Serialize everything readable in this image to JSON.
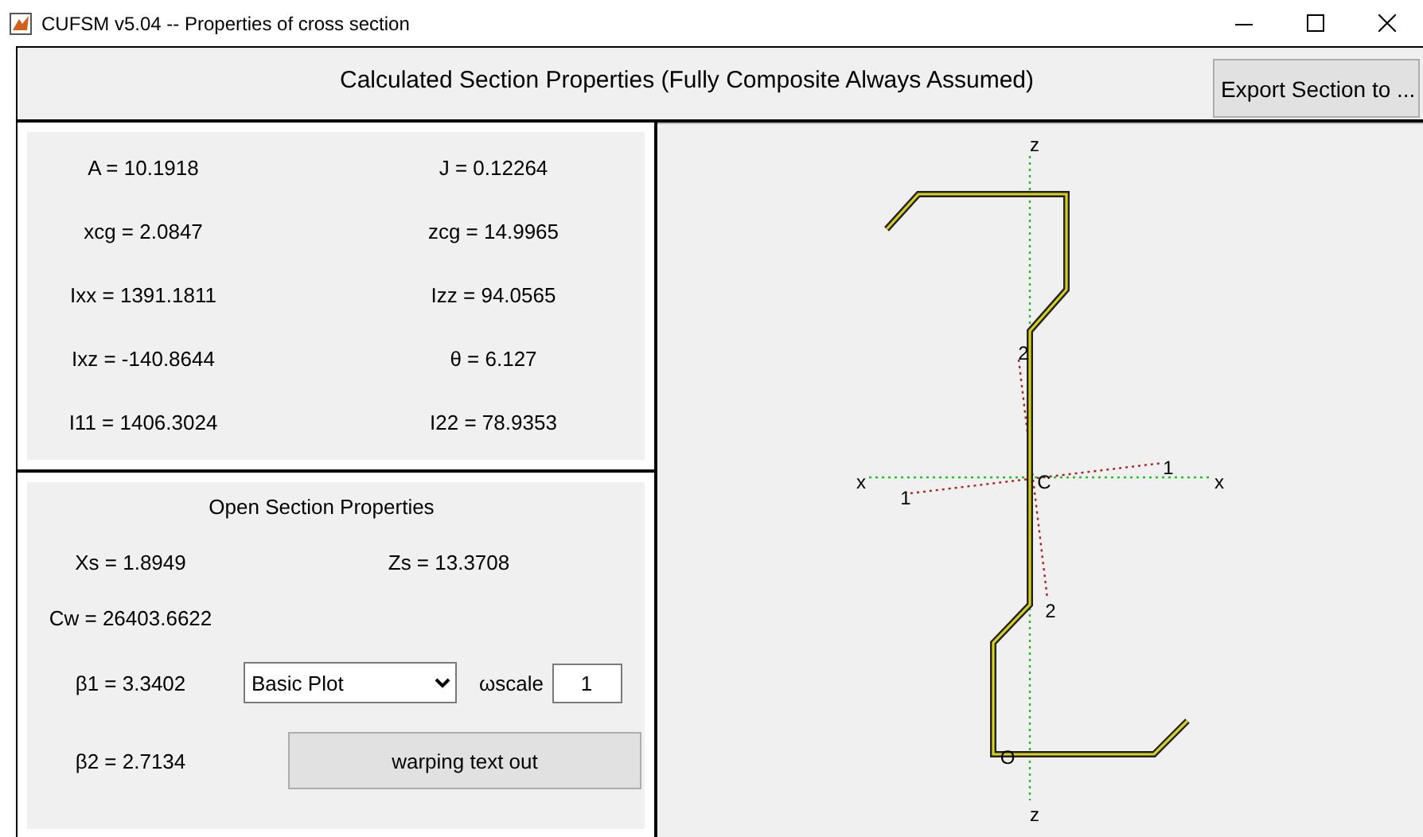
{
  "window": {
    "title": "CUFSM v5.04 -- Properties of cross section"
  },
  "header": {
    "title": "Calculated Section Properties (Fully Composite Always Assumed)",
    "export_button": "Export Section to ..."
  },
  "section_properties": [
    {
      "text": "A = 10.1918"
    },
    {
      "text": "J = 0.12264"
    },
    {
      "text": "xcg = 2.0847"
    },
    {
      "text": "zcg = 14.9965"
    },
    {
      "text": "Ixx = 1391.1811"
    },
    {
      "text": "Izz = 94.0565"
    },
    {
      "text": "Ixz = -140.8644"
    },
    {
      "text": "θ = 6.127"
    },
    {
      "text": "I11 = 1406.3024"
    },
    {
      "text": "I22 = 78.9353"
    }
  ],
  "open_section": {
    "title": "Open Section Properties",
    "xs": "Xs = 1.8949",
    "zs": "Zs = 13.3708",
    "cw": "Cw = 26403.6622",
    "beta1": "β1 = 3.3402",
    "beta2": "β2 = 2.7134",
    "plot_select": {
      "value": "Basic Plot"
    },
    "omega_scale": {
      "label": "ωscale",
      "value": "1"
    },
    "warping_button": "warping text out"
  },
  "plot": {
    "z_labels": [
      "z",
      "z"
    ],
    "x_labels": [
      "x",
      "x"
    ],
    "axis1_labels": [
      "1",
      "1"
    ],
    "axis2_labels": [
      "2",
      "2"
    ],
    "centroid_label": "C",
    "origin_label": "O"
  }
}
